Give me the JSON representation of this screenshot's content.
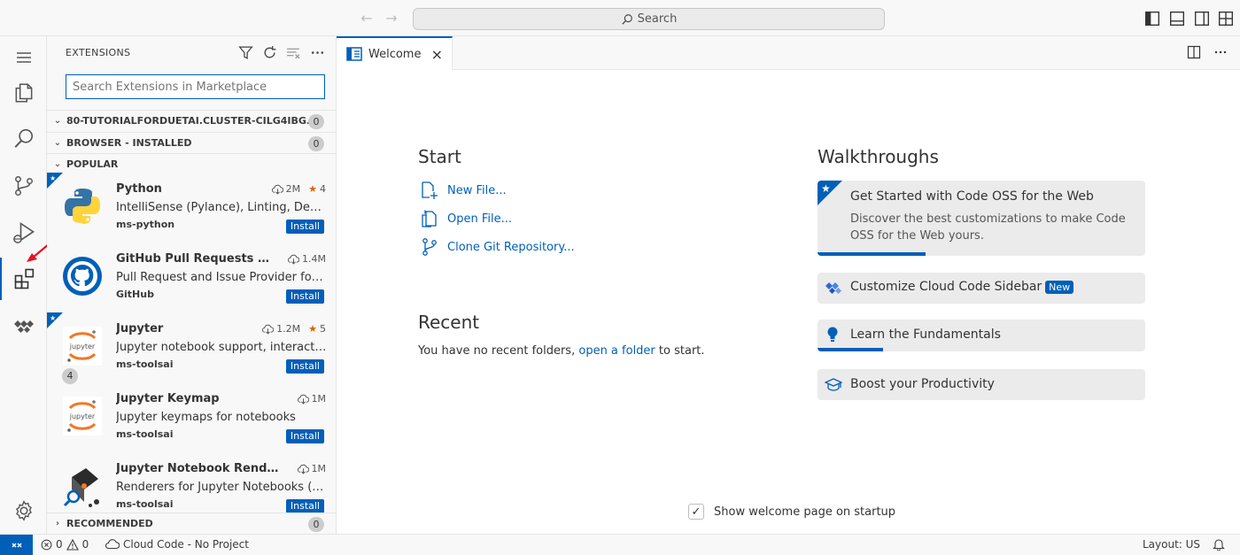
{
  "titlebar": {
    "search_label": "Search"
  },
  "sidebar": {
    "title": "EXTENSIONS",
    "search_placeholder": "Search Extensions in Marketplace",
    "sections": {
      "workspace": {
        "label": "80-TUTORIALFORDUETAI.CLUSTER-CILG4IBG...",
        "count": "0"
      },
      "installed": {
        "label": "BROWSER - INSTALLED",
        "count": "0"
      },
      "popular": {
        "label": "POPULAR"
      },
      "recommended": {
        "label": "RECOMMENDED",
        "count": "0"
      }
    },
    "extensions": [
      {
        "name": "Python",
        "description": "IntelliSense (Pylance), Linting, Debugging (multi-threaded, remote)",
        "publisher": "ms-python",
        "downloads": "2M",
        "rating": "4",
        "install": "Install"
      },
      {
        "name": "GitHub Pull Requests and Issues",
        "description": "Pull Request and Issue Provider for GitHub",
        "publisher": "GitHub",
        "downloads": "1.4M",
        "install": "Install"
      },
      {
        "name": "Jupyter",
        "description": "Jupyter notebook support, interactive programming",
        "publisher": "ms-toolsai",
        "downloads": "1.2M",
        "rating": "5",
        "install": "Install",
        "badge": "4"
      },
      {
        "name": "Jupyter Keymap",
        "description": "Jupyter keymaps for notebooks",
        "publisher": "ms-toolsai",
        "downloads": "1M",
        "install": "Install"
      },
      {
        "name": "Jupyter Notebook Renderers",
        "description": "Renderers for Jupyter Notebooks (with plotly, vega)",
        "publisher": "ms-toolsai",
        "downloads": "1M",
        "install": "Install"
      }
    ]
  },
  "editor": {
    "tab_label": "Welcome",
    "start": {
      "heading": "Start",
      "new_file": "New File...",
      "open_file": "Open File...",
      "clone_repo": "Clone Git Repository..."
    },
    "recent": {
      "heading": "Recent",
      "text_before": "You have no recent folders,",
      "link": "open a folder",
      "text_after": "to start."
    },
    "walkthroughs": {
      "heading": "Walkthroughs",
      "items": [
        {
          "title": "Get Started with Code OSS for the Web",
          "description": "Discover the best customizations to make Code OSS for the Web yours.",
          "progress": 0.33
        },
        {
          "title": "Customize Cloud Code Sidebar",
          "badge": "New"
        },
        {
          "title": "Learn the Fundamentals",
          "progress": 0.2
        },
        {
          "title": "Boost your Productivity"
        }
      ]
    },
    "startup_label": "Show welcome page on startup"
  },
  "statusbar": {
    "errors": "0",
    "warnings": "0",
    "cloud_code": "Cloud Code - No Project",
    "layout": "Layout: US"
  },
  "colors": {
    "accent": "#005fb8",
    "star": "#df6100",
    "arrow": "#e81123"
  }
}
